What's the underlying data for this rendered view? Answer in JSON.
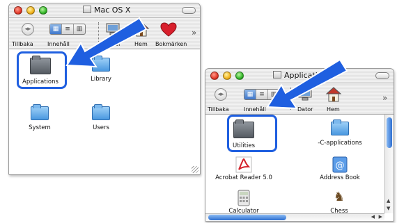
{
  "window1": {
    "title": "Mac OS X",
    "toolbar": {
      "back_label": "Tillbaka",
      "view_label": "Innehåll",
      "computer_label": "Dator",
      "home_label": "Hem",
      "bookmarks_label": "Bokmärken",
      "more_label": "»"
    },
    "items": [
      {
        "label": "Applications",
        "icon": "applications-folder-icon"
      },
      {
        "label": "Library",
        "icon": "library-folder-icon"
      },
      {
        "label": "System",
        "icon": "system-folder-icon"
      },
      {
        "label": "Users",
        "icon": "users-folder-icon"
      }
    ]
  },
  "window2": {
    "title": "Applications",
    "toolbar": {
      "back_label": "Tillbaka",
      "view_label": "Innehåll",
      "computer_label": "Dator",
      "home_label": "Hem",
      "more_label": "»"
    },
    "items": [
      {
        "label": "Utilities",
        "icon": "utilities-folder-icon"
      },
      {
        "label": "-C-applications",
        "icon": "folder-icon"
      },
      {
        "label": "Acrobat Reader 5.0",
        "icon": "acrobat-icon"
      },
      {
        "label": "Address Book",
        "icon": "address-book-icon"
      },
      {
        "label": "Calculator",
        "icon": "calculator-icon"
      },
      {
        "label": "Chess",
        "icon": "chess-icon"
      }
    ]
  },
  "colors": {
    "highlight": "#1f5fe0",
    "arrow": "#1f5fe0"
  }
}
